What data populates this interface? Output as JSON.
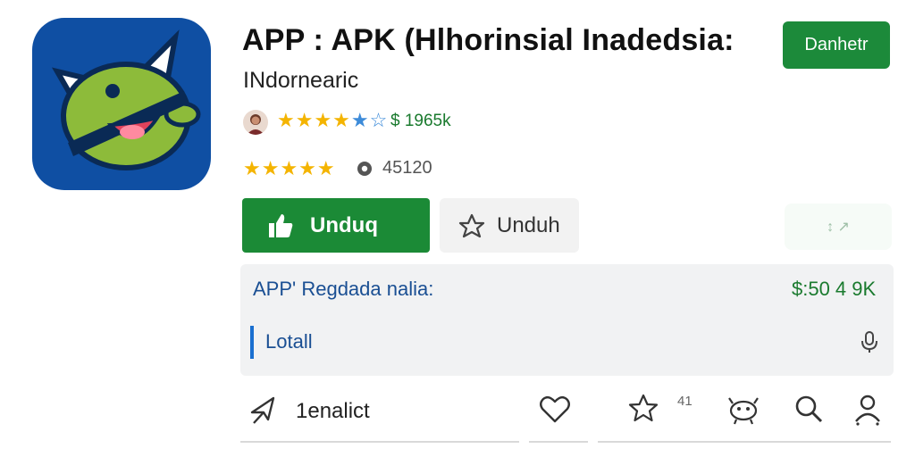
{
  "app": {
    "title": "APP : APK (Hlhorinsial Inadedsia:",
    "developer": "INdornearic",
    "install_label": "Danhetr"
  },
  "ratings": {
    "row1_stars": "★★★★★☆",
    "row1_price": "$ 1965k",
    "row2_stars": "★★★★★",
    "row2_count": "45120"
  },
  "actions": {
    "download_label": "Unduq",
    "wishlist_label": "Unduh",
    "share_label": "↕ ↗"
  },
  "info": {
    "label": "APP' Regdada nalia:",
    "price": "$:50 4 9K",
    "detail_label": "Lotall"
  },
  "bottom": {
    "label": "1enalict",
    "star_count": "41"
  },
  "colors": {
    "brand_green": "#1b8a36",
    "icon_blue": "#0f4fa3",
    "link_blue": "#1a4f93",
    "star_gold": "#f4b400",
    "star_blue": "#3d8bd9"
  }
}
